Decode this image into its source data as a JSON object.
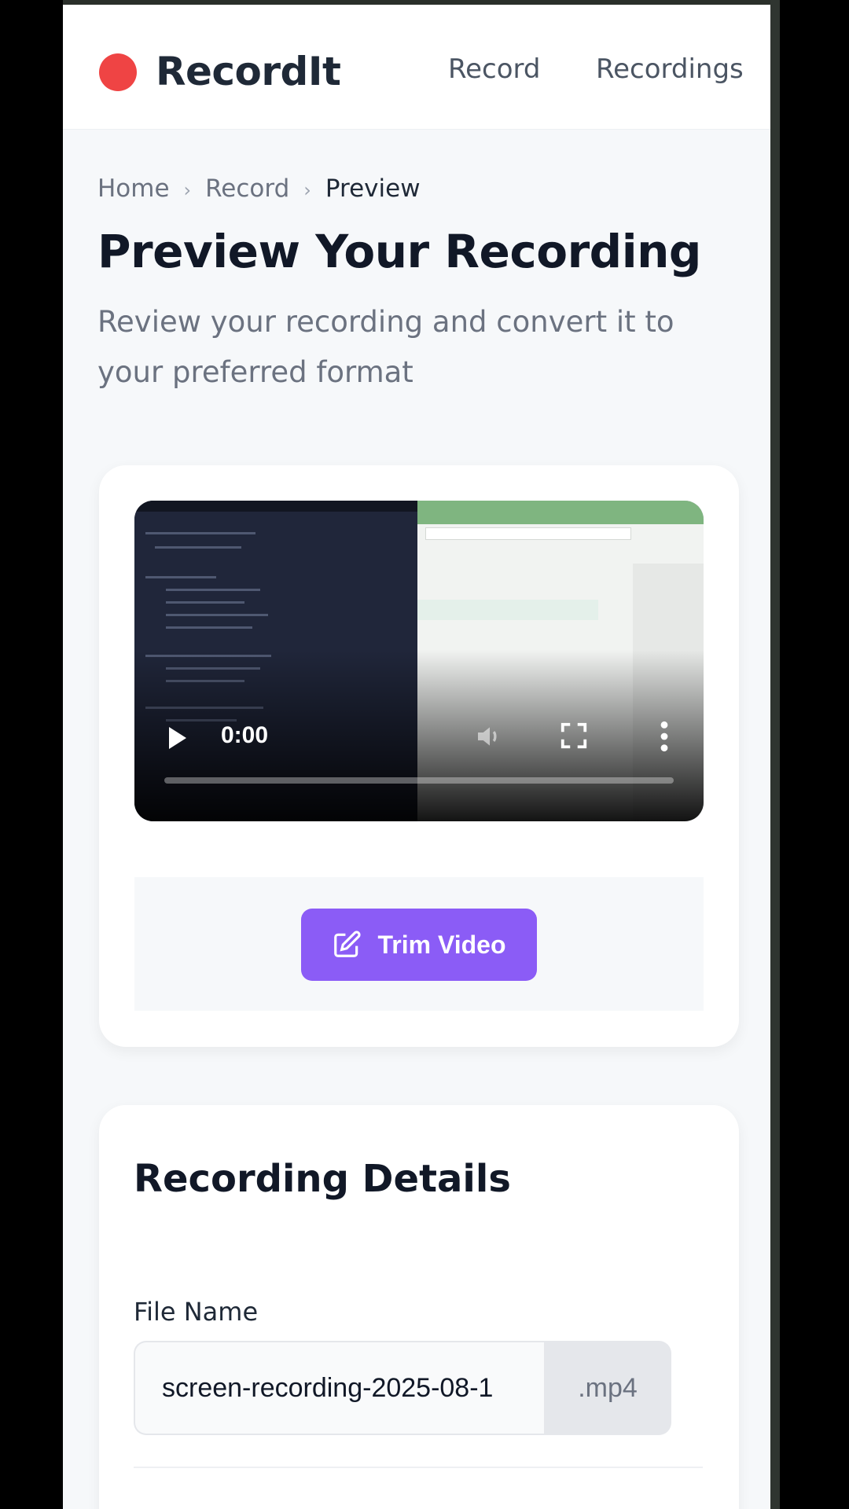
{
  "header": {
    "brand": "RecordIt",
    "nav": {
      "record": "Record",
      "recordings": "Recordings"
    }
  },
  "breadcrumb": {
    "home": "Home",
    "record": "Record",
    "current": "Preview"
  },
  "page": {
    "title": "Preview Your Recording",
    "subtitle": "Review your recording and convert it to your preferred format"
  },
  "video": {
    "time": "0:00",
    "progress": 0,
    "icons": [
      "play-icon",
      "volume-icon",
      "fullscreen-icon",
      "more-vertical-icon"
    ]
  },
  "trim": {
    "label": "Trim Video",
    "icon": "edit-icon"
  },
  "details": {
    "title": "Recording Details",
    "file_name_label": "File Name",
    "file_name_value": "screen-recording-2025-08-1",
    "extension": ".mp4"
  },
  "colors": {
    "accent": "#8b5cf6",
    "brand_dot": "#ef4444",
    "page_bg": "#f6f8fa"
  }
}
